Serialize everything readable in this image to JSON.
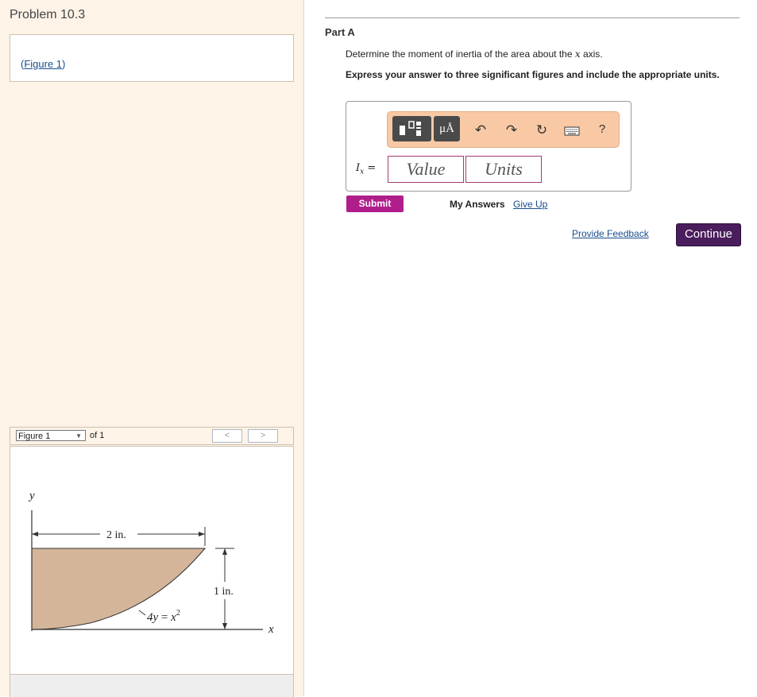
{
  "left_panel": {
    "problem_title": "Problem 10.3",
    "figure_link": "Figure 1",
    "figure_bar": {
      "select_value": "Figure 1",
      "of_label": "of 1",
      "prev": "<",
      "next": ">"
    },
    "figure": {
      "y_axis": "y",
      "x_axis": "x",
      "width_dim": "2 in.",
      "height_dim": "1 in.",
      "curve_eq_lhs": "4y",
      "curve_eq_eq": "=",
      "curve_eq_rhs": "x",
      "curve_eq_exp": "2"
    }
  },
  "part": {
    "title": "Part A",
    "question_prefix": "Determine the moment of inertia of the area about the ",
    "question_var": "x",
    "question_suffix": " axis.",
    "instruction": "Express your answer to three significant figures and include the appropriate units.",
    "toolbar": {
      "templates_icon": "templates-icon",
      "units_label": "μÅ",
      "undo_icon": "undo-icon",
      "redo_icon": "redo-icon",
      "reset_icon": "reset-icon",
      "keyboard_icon": "keyboard-icon",
      "help_label": "?"
    },
    "equation_var": "I",
    "equation_sub": "x",
    "equation_eq": "=",
    "value_placeholder": "Value",
    "units_placeholder": "Units",
    "submit_label": "Submit",
    "my_answers_label": "My Answers",
    "give_up_label": "Give Up"
  },
  "footer": {
    "feedback_label": "Provide Feedback",
    "continue_label": "Continue"
  },
  "colors": {
    "left_bg": "#fdf3e7",
    "area_fill": "#d4b59a",
    "submit_bg": "#b01e8c",
    "continue_bg": "#4a1d5c",
    "toolbar_bg": "#f8c9a4",
    "link": "#1a4d8c"
  }
}
